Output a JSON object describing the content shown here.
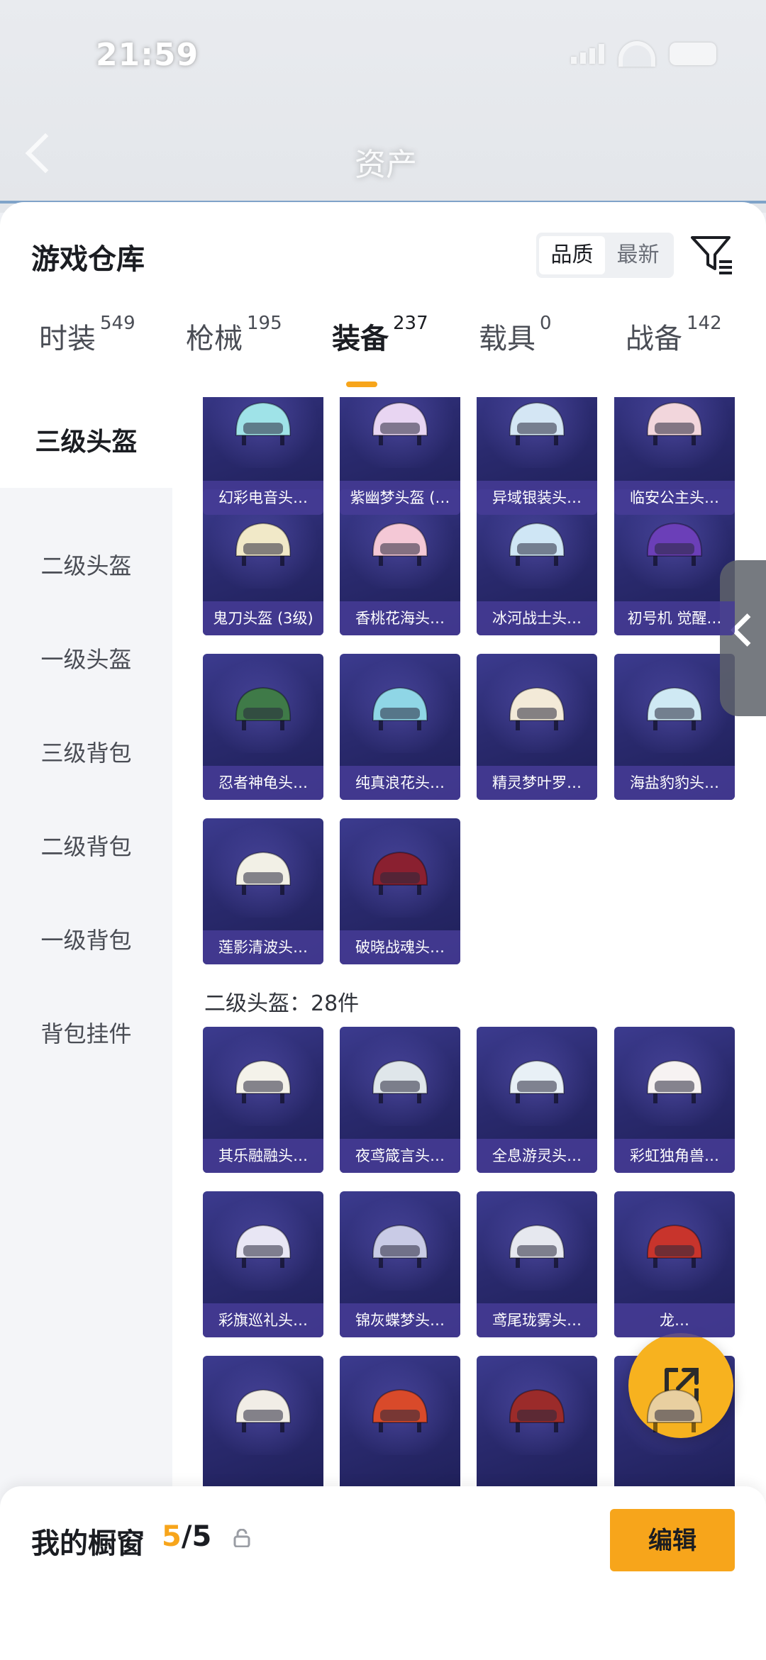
{
  "status_bar": {
    "time": "21:59"
  },
  "nav": {
    "title": "资产"
  },
  "sheet": {
    "title": "游戏仓库",
    "sort_options": [
      "品质",
      "最新"
    ]
  },
  "tabs": [
    {
      "label": "时装",
      "count": "549"
    },
    {
      "label": "枪械",
      "count": "195"
    },
    {
      "label": "装备",
      "count": "237"
    },
    {
      "label": "载具",
      "count": "0"
    },
    {
      "label": "战备",
      "count": "142"
    }
  ],
  "categories": [
    "三级头盔",
    "二级头盔",
    "一级头盔",
    "三级背包",
    "二级背包",
    "一级背包",
    "背包挂件"
  ],
  "level3_items": [
    "幻彩电音头…",
    "紫幽梦头盔 (…",
    "异域银装头…",
    "临安公主头…",
    "鬼刀头盔 (3级)",
    "香桃花海头…",
    "冰河战士头…",
    "初号机 觉醒…",
    "忍者神龟头…",
    "纯真浪花头…",
    "精灵梦叶罗…",
    "海盐豹豹头…",
    "莲影清波头…",
    "破晓战魂头…"
  ],
  "section2": {
    "label": "二级头盔：28件"
  },
  "level2_items": [
    "其乐融融头…",
    "夜鸢箴言头…",
    "全息游灵头…",
    "彩虹独角兽…",
    "彩旗巡礼头…",
    "锦灰蝶梦头…",
    "鸢尾珑雾头…",
    "龙…",
    "",
    "",
    "",
    ""
  ],
  "bottom": {
    "title": "我的橱窗",
    "current": "5",
    "total": "/5",
    "edit_label": "编辑"
  },
  "colors": {
    "accent": "#f7a51b",
    "card_bg": "#2a2a6e",
    "label_bg": "#463c96"
  }
}
